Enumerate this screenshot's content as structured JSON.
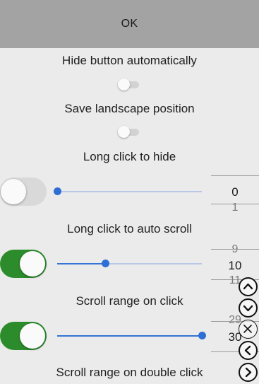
{
  "topbar": {
    "ok_label": "OK"
  },
  "settings": {
    "hide_button_automatically": {
      "label": "Hide button automatically",
      "enabled": false
    },
    "save_landscape_position": {
      "label": "Save landscape position",
      "enabled": false
    },
    "long_click_to_hide": {
      "label": "Long click to hide",
      "enabled": false,
      "slider_fraction": 0.0,
      "picker_prev": "",
      "picker_value": "0",
      "picker_next": "1"
    },
    "long_click_to_auto_scroll": {
      "label": "Long click to auto scroll",
      "enabled": true,
      "slider_fraction": 0.33,
      "picker_prev": "9",
      "picker_value": "10",
      "picker_next": "11"
    },
    "scroll_range_on_click": {
      "label": "Scroll range on click",
      "enabled": true,
      "slider_fraction": 1.0,
      "picker_prev": "29",
      "picker_value": "30",
      "picker_next": ""
    },
    "scroll_range_on_double_click": {
      "label": "Scroll range on double click"
    }
  },
  "floating_controls": {
    "icons": [
      "chevron-up-icon",
      "chevron-down-icon",
      "close-icon",
      "chevron-left-icon",
      "chevron-right-icon"
    ]
  },
  "colors": {
    "topbar": "#a3a3a3",
    "background": "#ebebeb",
    "toggle_on": "#2c8c2c",
    "slider_accent": "#2e6fd6"
  }
}
